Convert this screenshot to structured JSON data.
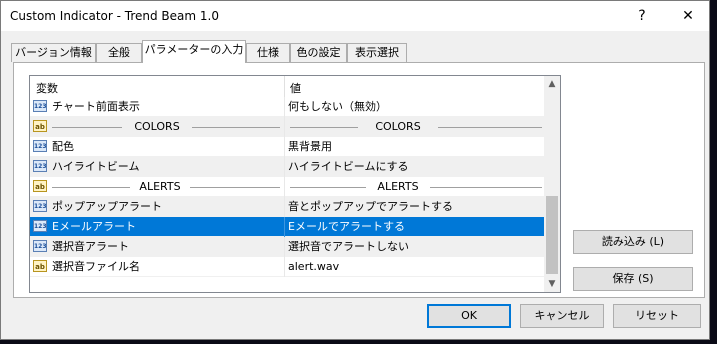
{
  "window": {
    "title": "Custom Indicator - Trend Beam 1.0",
    "help_glyph": "?",
    "close_glyph": "✕"
  },
  "tabs": [
    {
      "label": "バージョン情報"
    },
    {
      "label": "全般"
    },
    {
      "label": "パラメーターの入力",
      "active": true
    },
    {
      "label": "仕様"
    },
    {
      "label": "色の設定"
    },
    {
      "label": "表示選択"
    }
  ],
  "grid": {
    "columns": [
      "変数",
      "値"
    ],
    "rows": [
      {
        "type": "param",
        "icon": "123",
        "name": "チャート前面表示",
        "value": "何もしない（無効）"
      },
      {
        "type": "group",
        "icon": "ab",
        "name": "COLORS",
        "value": "COLORS"
      },
      {
        "type": "param",
        "icon": "123",
        "name": "配色",
        "value": "黒背景用"
      },
      {
        "type": "param",
        "icon": "123",
        "name": "ハイライトビーム",
        "value": "ハイライトビームにする"
      },
      {
        "type": "group",
        "icon": "ab",
        "name": "ALERTS",
        "value": "ALERTS"
      },
      {
        "type": "param",
        "icon": "123",
        "name": "ポップアップアラート",
        "value": "音とポップアップでアラートする"
      },
      {
        "type": "param",
        "icon": "123",
        "name": "Eメールアラート",
        "value": "Eメールでアラートする",
        "selected": true
      },
      {
        "type": "param",
        "icon": "123",
        "name": "選択音アラート",
        "value": "選択音でアラートしない"
      },
      {
        "type": "param",
        "icon": "ab",
        "name": "選択音ファイル名",
        "value": "alert.wav"
      }
    ]
  },
  "side_buttons": {
    "load": "読み込み (L)",
    "save": "保存 (S)"
  },
  "footer_buttons": {
    "ok": "OK",
    "cancel": "キャンセル",
    "reset": "リセット"
  },
  "colors": {
    "selection": "#0078d7",
    "dialog_bg": "#f0f0f0"
  }
}
